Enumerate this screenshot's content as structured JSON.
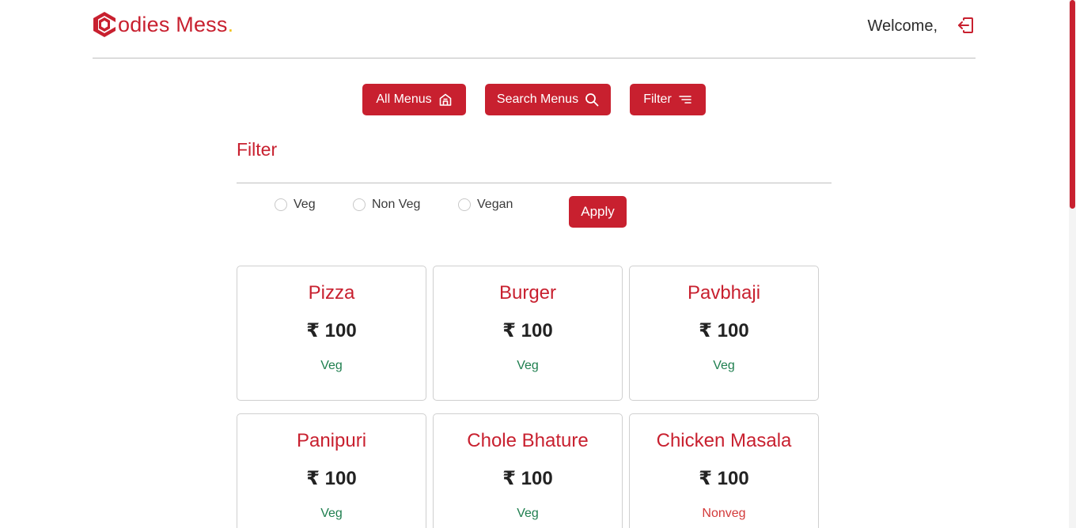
{
  "brand": {
    "name": "odies Mess",
    "dot": ".",
    "logo_icon": "hexagon-c-logo-icon",
    "color": "#c8202f",
    "dot_color": "#f2c21b"
  },
  "header": {
    "welcome": "Welcome,",
    "logout_icon": "logout-icon"
  },
  "toolbar": {
    "all_menus": "All Menus",
    "search_menus": "Search Menus",
    "filter": "Filter"
  },
  "filter": {
    "title": "Filter",
    "options": [
      "Veg",
      "Non Veg",
      "Vegan"
    ],
    "apply": "Apply"
  },
  "menu_items": [
    {
      "name": "Pizza",
      "price": "₹ 100",
      "type": "Veg"
    },
    {
      "name": "Burger",
      "price": "₹ 100",
      "type": "Veg"
    },
    {
      "name": "Pavbhaji",
      "price": "₹ 100",
      "type": "Veg"
    },
    {
      "name": "Panipuri",
      "price": "₹ 100",
      "type": "Veg"
    },
    {
      "name": "Chole Bhature",
      "price": "₹ 100",
      "type": "Veg"
    },
    {
      "name": "Chicken Masala",
      "price": "₹ 100",
      "type": "Nonveg"
    }
  ]
}
